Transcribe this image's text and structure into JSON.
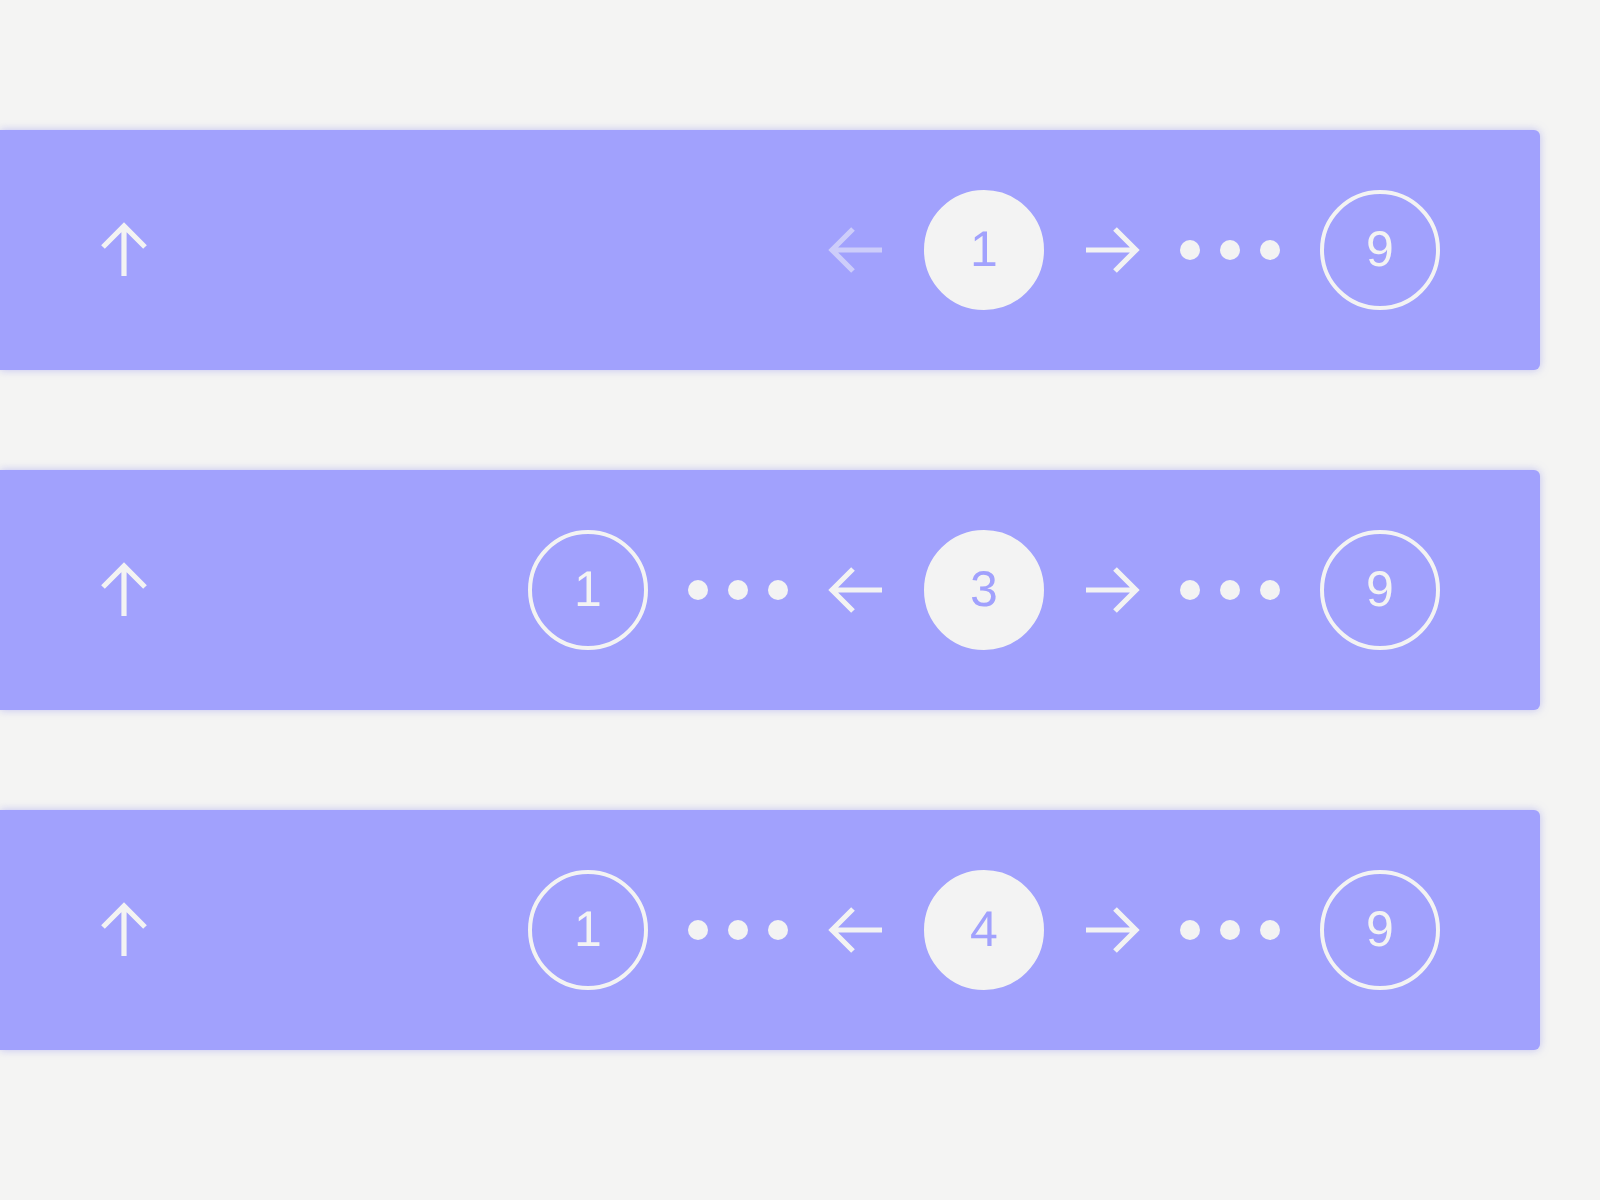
{
  "pagers": [
    {
      "items": [
        {
          "kind": "prev",
          "disabled": true
        },
        {
          "kind": "page",
          "label": "1",
          "selected": true
        },
        {
          "kind": "next",
          "disabled": false
        },
        {
          "kind": "ellipsis"
        },
        {
          "kind": "page",
          "label": "9",
          "selected": false
        }
      ]
    },
    {
      "items": [
        {
          "kind": "page",
          "label": "1",
          "selected": false
        },
        {
          "kind": "ellipsis"
        },
        {
          "kind": "prev",
          "disabled": false
        },
        {
          "kind": "page",
          "label": "3",
          "selected": true
        },
        {
          "kind": "next",
          "disabled": false
        },
        {
          "kind": "ellipsis"
        },
        {
          "kind": "page",
          "label": "9",
          "selected": false
        }
      ]
    },
    {
      "items": [
        {
          "kind": "page",
          "label": "1",
          "selected": false
        },
        {
          "kind": "ellipsis"
        },
        {
          "kind": "prev",
          "disabled": false
        },
        {
          "kind": "page",
          "label": "4",
          "selected": true
        },
        {
          "kind": "next",
          "disabled": false
        },
        {
          "kind": "ellipsis"
        },
        {
          "kind": "page",
          "label": "9",
          "selected": false
        }
      ]
    }
  ]
}
